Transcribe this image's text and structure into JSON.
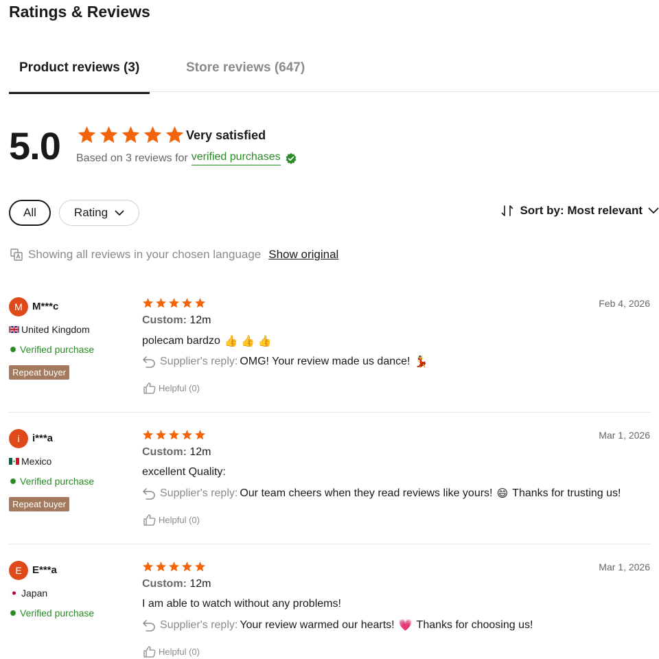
{
  "header": {
    "title": "Ratings & Reviews"
  },
  "tabs": [
    {
      "label": "Product reviews (3)",
      "active": true
    },
    {
      "label": "Store reviews (647)",
      "active": false
    }
  ],
  "summary": {
    "score": "5.0",
    "stars": 5,
    "satisfaction": "Very satisfied",
    "based_prefix": "Based on 3 reviews for",
    "verified_link": "verified purchases"
  },
  "filters": {
    "all_label": "All",
    "rating_label": "Rating",
    "sort_label": "Sort by: Most relevant"
  },
  "language": {
    "notice": "Showing all reviews in your chosen language",
    "show_original": "Show original"
  },
  "colors": {
    "star": "#f2630a",
    "verified": "#2a8a26",
    "avatar": "#e0491a",
    "repeat_badge": "#a37a5e"
  },
  "reviews": [
    {
      "initial": "M",
      "name": "M***c",
      "country": "United Kingdom",
      "flag": "uk",
      "verified": "Verified purchase",
      "repeat": "Repeat buyer",
      "stars": 5,
      "date": "Feb 4, 2026",
      "custom_key": "Custom",
      "custom_value": "12m",
      "text": "polecam bardzo",
      "text_emoji": "👍 👍 👍",
      "reply_label": "Supplier's reply:",
      "reply_text": "OMG! Your review made us dance!",
      "reply_emoji": "💃",
      "reply_tail": "",
      "helpful": "Helpful (0)"
    },
    {
      "initial": "i",
      "name": "i***a",
      "country": "Mexico",
      "flag": "mx",
      "verified": "Verified purchase",
      "repeat": "Repeat buyer",
      "stars": 5,
      "date": "Mar 1, 2026",
      "custom_key": "Custom",
      "custom_value": "12m",
      "text": "excellent Quality:",
      "text_emoji": "",
      "reply_label": "Supplier's reply:",
      "reply_text": "Our team cheers when they read reviews like yours!",
      "reply_emoji": "😄",
      "reply_tail": "Thanks for trusting us!",
      "helpful": "Helpful (0)"
    },
    {
      "initial": "E",
      "name": "E***a",
      "country": "Japan",
      "flag": "jp",
      "verified": "Verified purchase",
      "repeat": "",
      "stars": 5,
      "date": "Mar 1, 2026",
      "custom_key": "Custom",
      "custom_value": "12m",
      "text": "I am able to watch without any problems!",
      "text_emoji": "",
      "reply_label": "Supplier's reply:",
      "reply_text": "Your review warmed our hearts!",
      "reply_emoji": "💗",
      "reply_tail": "Thanks for choosing us!",
      "helpful": "Helpful (0)"
    }
  ]
}
